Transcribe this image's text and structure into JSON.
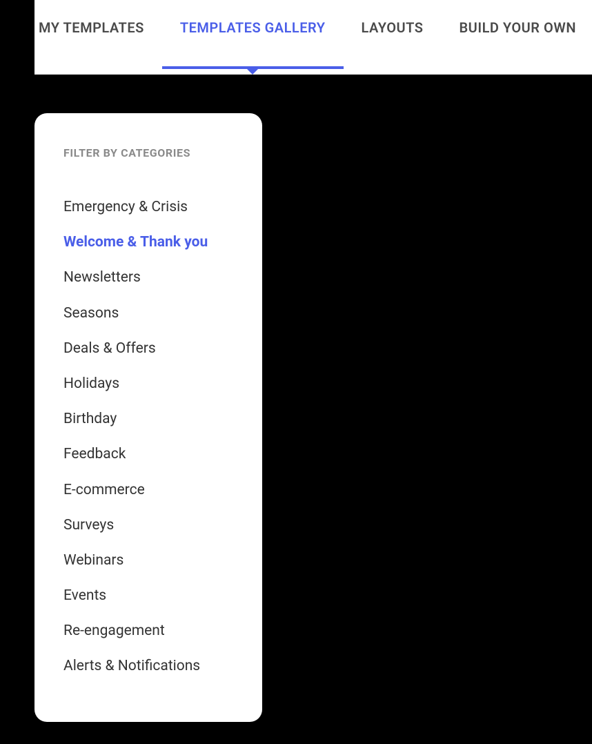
{
  "tabs": [
    {
      "label": "MY TEMPLATES",
      "active": false
    },
    {
      "label": "TEMPLATES GALLERY",
      "active": true
    },
    {
      "label": "LAYOUTS",
      "active": false
    },
    {
      "label": "BUILD YOUR OWN",
      "active": false
    }
  ],
  "filter": {
    "heading": "FILTER BY CATEGORIES",
    "categories": [
      {
        "label": "Emergency & Crisis",
        "selected": false
      },
      {
        "label": "Welcome  & Thank you",
        "selected": true
      },
      {
        "label": "Newsletters",
        "selected": false
      },
      {
        "label": "Seasons",
        "selected": false
      },
      {
        "label": "Deals & Offers",
        "selected": false
      },
      {
        "label": "Holidays",
        "selected": false
      },
      {
        "label": "Birthday",
        "selected": false
      },
      {
        "label": "Feedback",
        "selected": false
      },
      {
        "label": "E-commerce",
        "selected": false
      },
      {
        "label": "Surveys",
        "selected": false
      },
      {
        "label": "Webinars",
        "selected": false
      },
      {
        "label": "Events",
        "selected": false
      },
      {
        "label": "Re-engagement",
        "selected": false
      },
      {
        "label": "Alerts & Notifications",
        "selected": false
      }
    ]
  }
}
